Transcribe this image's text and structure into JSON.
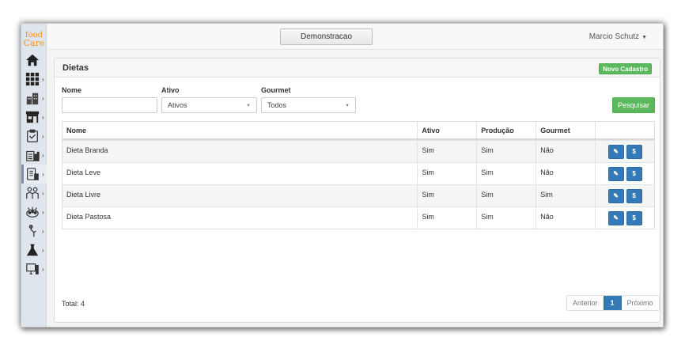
{
  "brand": {
    "line1": "food",
    "line2": "Care"
  },
  "sidebar": {
    "items": [
      {
        "icon": "home-icon",
        "has_submenu": false
      },
      {
        "icon": "grid-icon",
        "has_submenu": true
      },
      {
        "icon": "buildings-icon",
        "has_submenu": true
      },
      {
        "icon": "store-icon",
        "has_submenu": true
      },
      {
        "icon": "clipboard-icon",
        "has_submenu": true
      },
      {
        "icon": "chart-icon",
        "has_submenu": true
      },
      {
        "icon": "diet-list-icon",
        "has_submenu": true,
        "active": true
      },
      {
        "icon": "people-icon",
        "has_submenu": true
      },
      {
        "icon": "food-tray-icon",
        "has_submenu": true
      },
      {
        "icon": "tool-icon",
        "has_submenu": true
      },
      {
        "icon": "flask-icon",
        "has_submenu": true
      },
      {
        "icon": "monitor-icon",
        "has_submenu": true
      }
    ]
  },
  "topbar": {
    "environment": "Demonstracao",
    "user": "Marcio Schutz"
  },
  "panel": {
    "title": "Dietas",
    "new_button": "Novo Cadastro"
  },
  "filters": {
    "nome": {
      "label": "Nome",
      "value": ""
    },
    "ativo": {
      "label": "Ativo",
      "selected": "Ativos"
    },
    "gourmet": {
      "label": "Gourmet",
      "selected": "Todos"
    },
    "search_button": "Pesquisar"
  },
  "table": {
    "headers": [
      "Nome",
      "Ativo",
      "Produção",
      "Gourmet",
      ""
    ],
    "rows": [
      [
        "Dieta Branda",
        "Sim",
        "Sim",
        "Não"
      ],
      [
        "Dieta Leve",
        "Sim",
        "Sim",
        "Não"
      ],
      [
        "Dieta Livre",
        "Sim",
        "Sim",
        "Sim"
      ],
      [
        "Dieta Pastosa",
        "Sim",
        "Sim",
        "Não"
      ]
    ],
    "action_icons": [
      "pencil-icon",
      "dollar-icon"
    ],
    "action_glyphs": [
      "✎",
      "$"
    ]
  },
  "footer": {
    "total": "Total: 4",
    "pager": {
      "prev": "Anterior",
      "current": "1",
      "next": "Próximo"
    }
  },
  "colors": {
    "primary": "#337ab7",
    "success": "#5cb85c",
    "logo": "#f0961c"
  }
}
